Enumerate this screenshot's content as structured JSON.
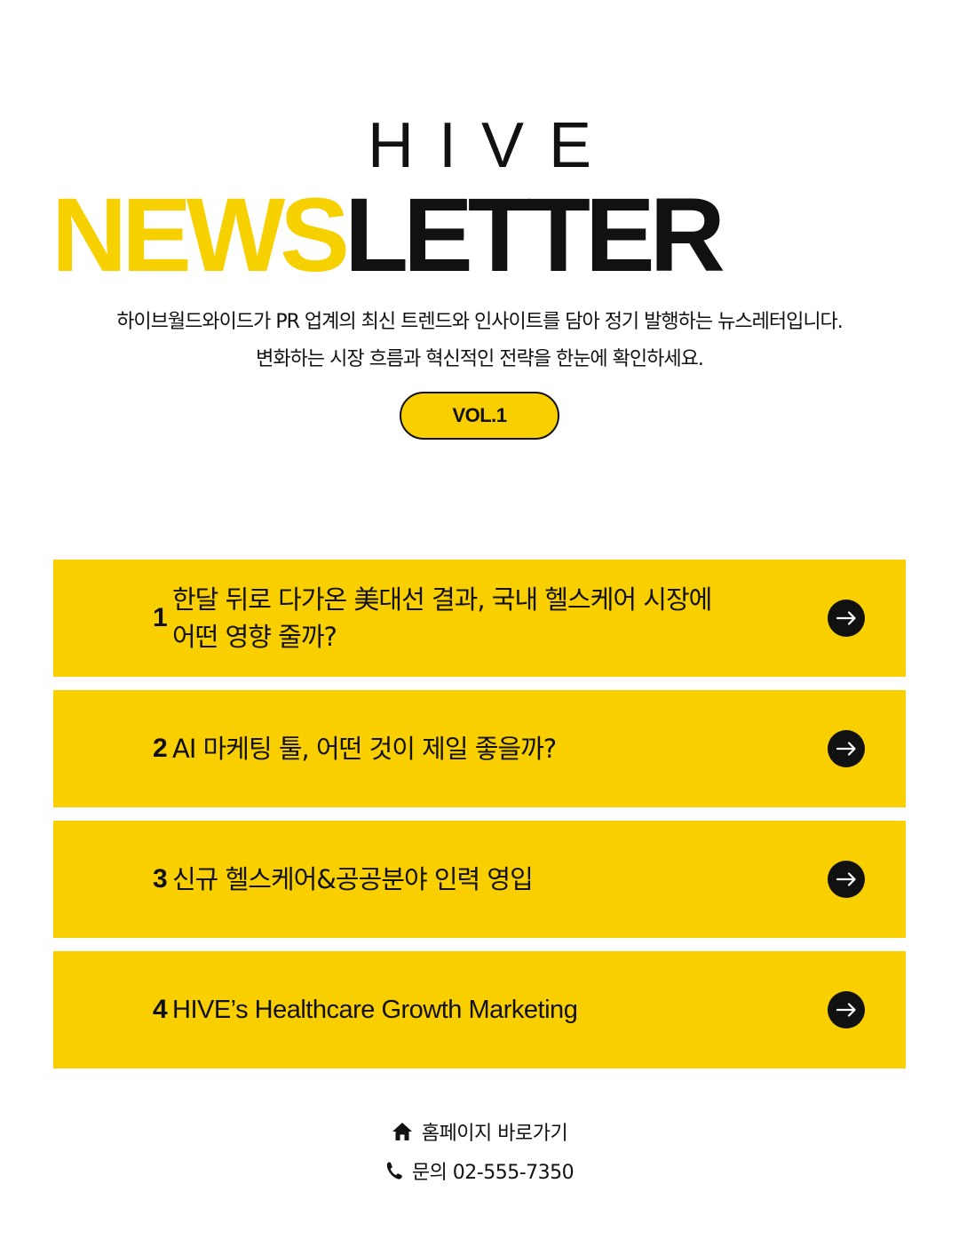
{
  "header": {
    "brand": "HIVE",
    "headline_yellow": "NEWS",
    "headline_black": "LETTER",
    "intro_line1": "하이브월드와이드가 PR 업계의 최신 트렌드와 인사이트를 담아 정기 발행하는 뉴스레터입니다.",
    "intro_line2": "변화하는 시장 흐름과 혁신적인 전략을 한눈에 확인하세요.",
    "volume": "VOL.1"
  },
  "articles": [
    {
      "number": "1",
      "title_line1": "한달 뒤로 다가온 美대선 결과, 국내 헬스케어 시장에",
      "title_line2": "어떤 영향 줄까?"
    },
    {
      "number": "2",
      "title_line1": "AI 마케팅 툴, 어떤 것이 제일 좋을까?",
      "title_line2": ""
    },
    {
      "number": "3",
      "title_line1": "신규 헬스케어&공공분야 인력 영입",
      "title_line2": ""
    },
    {
      "number": "4",
      "title_line1": "HIVE’s Healthcare Growth Marketing",
      "title_line2": ""
    }
  ],
  "footer": {
    "homepage_label": "홈페이지 바로가기",
    "contact_label": "문의 02-555-7350"
  },
  "icons": {
    "article_link": "arrow-right-circle-icon",
    "homepage": "home-icon",
    "contact": "phone-icon"
  },
  "colors": {
    "accent_yellow": "#F9CF00",
    "text_black": "#111111",
    "background": "#ffffff"
  }
}
